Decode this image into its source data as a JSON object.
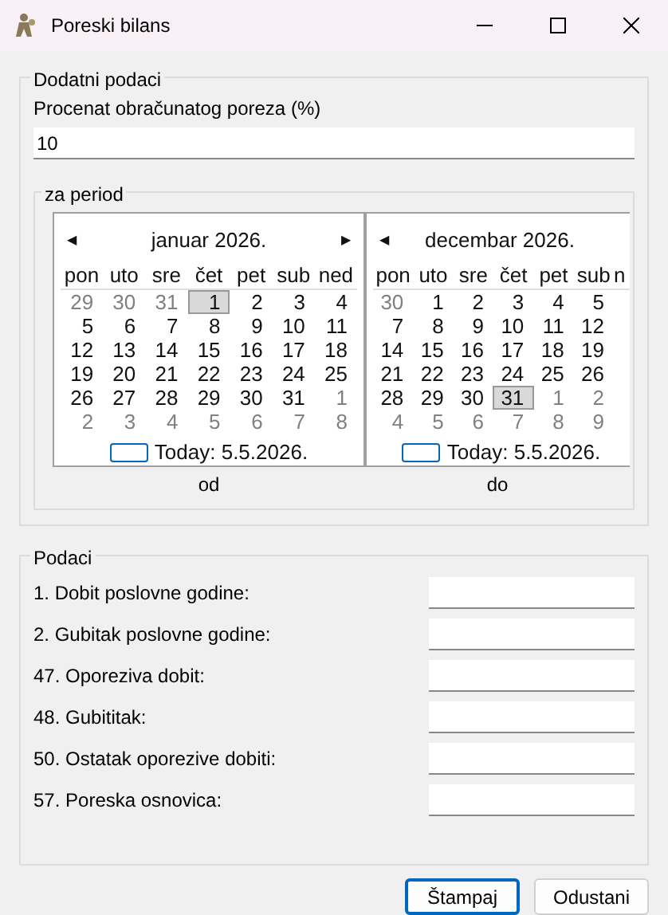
{
  "window": {
    "title": "Poreski bilans"
  },
  "extra": {
    "title": "Dodatni podaci",
    "tax_label": "Procenat obračunatog poreza (%)",
    "tax_value": "10"
  },
  "period": {
    "title": "za period",
    "calendars": [
      {
        "prev": "◀",
        "next": "▶",
        "month": "januar 2026.",
        "weekdays": [
          "pon",
          "uto",
          "sre",
          "čet",
          "pet",
          "sub",
          "ned"
        ],
        "today": "Today: 5.5.2026.",
        "caption": "od",
        "weeks": [
          [
            {
              "day": "29",
              "other": true,
              "selected": false
            },
            {
              "day": "30",
              "other": true,
              "selected": false
            },
            {
              "day": "31",
              "other": true,
              "selected": false
            },
            {
              "day": "1",
              "other": false,
              "selected": true
            },
            {
              "day": "2",
              "other": false,
              "selected": false
            },
            {
              "day": "3",
              "other": false,
              "selected": false
            },
            {
              "day": "4",
              "other": false,
              "selected": false
            }
          ],
          [
            {
              "day": "5",
              "other": false,
              "selected": false
            },
            {
              "day": "6",
              "other": false,
              "selected": false
            },
            {
              "day": "7",
              "other": false,
              "selected": false
            },
            {
              "day": "8",
              "other": false,
              "selected": false
            },
            {
              "day": "9",
              "other": false,
              "selected": false
            },
            {
              "day": "10",
              "other": false,
              "selected": false
            },
            {
              "day": "11",
              "other": false,
              "selected": false
            }
          ],
          [
            {
              "day": "12",
              "other": false,
              "selected": false
            },
            {
              "day": "13",
              "other": false,
              "selected": false
            },
            {
              "day": "14",
              "other": false,
              "selected": false
            },
            {
              "day": "15",
              "other": false,
              "selected": false
            },
            {
              "day": "16",
              "other": false,
              "selected": false
            },
            {
              "day": "17",
              "other": false,
              "selected": false
            },
            {
              "day": "18",
              "other": false,
              "selected": false
            }
          ],
          [
            {
              "day": "19",
              "other": false,
              "selected": false
            },
            {
              "day": "20",
              "other": false,
              "selected": false
            },
            {
              "day": "21",
              "other": false,
              "selected": false
            },
            {
              "day": "22",
              "other": false,
              "selected": false
            },
            {
              "day": "23",
              "other": false,
              "selected": false
            },
            {
              "day": "24",
              "other": false,
              "selected": false
            },
            {
              "day": "25",
              "other": false,
              "selected": false
            }
          ],
          [
            {
              "day": "26",
              "other": false,
              "selected": false
            },
            {
              "day": "27",
              "other": false,
              "selected": false
            },
            {
              "day": "28",
              "other": false,
              "selected": false
            },
            {
              "day": "29",
              "other": false,
              "selected": false
            },
            {
              "day": "30",
              "other": false,
              "selected": false
            },
            {
              "day": "31",
              "other": false,
              "selected": false
            },
            {
              "day": "1",
              "other": true,
              "selected": false
            }
          ],
          [
            {
              "day": "2",
              "other": true,
              "selected": false
            },
            {
              "day": "3",
              "other": true,
              "selected": false
            },
            {
              "day": "4",
              "other": true,
              "selected": false
            },
            {
              "day": "5",
              "other": true,
              "selected": false
            },
            {
              "day": "6",
              "other": true,
              "selected": false
            },
            {
              "day": "7",
              "other": true,
              "selected": false
            },
            {
              "day": "8",
              "other": true,
              "selected": false
            }
          ]
        ]
      },
      {
        "prev": "◀",
        "month": "decembar 2026.",
        "weekdays": [
          "pon",
          "uto",
          "sre",
          "čet",
          "pet",
          "sub",
          "n"
        ],
        "today": "Today: 5.5.2026.",
        "caption": "do",
        "weeks": [
          [
            {
              "day": "30",
              "other": true,
              "selected": false
            },
            {
              "day": "1",
              "other": false,
              "selected": false
            },
            {
              "day": "2",
              "other": false,
              "selected": false
            },
            {
              "day": "3",
              "other": false,
              "selected": false
            },
            {
              "day": "4",
              "other": false,
              "selected": false
            },
            {
              "day": "5",
              "other": false,
              "selected": false
            }
          ],
          [
            {
              "day": "7",
              "other": false,
              "selected": false
            },
            {
              "day": "8",
              "other": false,
              "selected": false
            },
            {
              "day": "9",
              "other": false,
              "selected": false
            },
            {
              "day": "10",
              "other": false,
              "selected": false
            },
            {
              "day": "11",
              "other": false,
              "selected": false
            },
            {
              "day": "12",
              "other": false,
              "selected": false
            }
          ],
          [
            {
              "day": "14",
              "other": false,
              "selected": false
            },
            {
              "day": "15",
              "other": false,
              "selected": false
            },
            {
              "day": "16",
              "other": false,
              "selected": false
            },
            {
              "day": "17",
              "other": false,
              "selected": false
            },
            {
              "day": "18",
              "other": false,
              "selected": false
            },
            {
              "day": "19",
              "other": false,
              "selected": false
            }
          ],
          [
            {
              "day": "21",
              "other": false,
              "selected": false
            },
            {
              "day": "22",
              "other": false,
              "selected": false
            },
            {
              "day": "23",
              "other": false,
              "selected": false
            },
            {
              "day": "24",
              "other": false,
              "selected": false
            },
            {
              "day": "25",
              "other": false,
              "selected": false
            },
            {
              "day": "26",
              "other": false,
              "selected": false
            }
          ],
          [
            {
              "day": "28",
              "other": false,
              "selected": false
            },
            {
              "day": "29",
              "other": false,
              "selected": false
            },
            {
              "day": "30",
              "other": false,
              "selected": false
            },
            {
              "day": "31",
              "other": false,
              "selected": true
            },
            {
              "day": "1",
              "other": true,
              "selected": false
            },
            {
              "day": "2",
              "other": true,
              "selected": false
            }
          ],
          [
            {
              "day": "4",
              "other": true,
              "selected": false
            },
            {
              "day": "5",
              "other": true,
              "selected": false
            },
            {
              "day": "6",
              "other": true,
              "selected": false
            },
            {
              "day": "7",
              "other": true,
              "selected": false
            },
            {
              "day": "8",
              "other": true,
              "selected": false
            },
            {
              "day": "9",
              "other": true,
              "selected": false
            }
          ]
        ]
      }
    ]
  },
  "data": {
    "title": "Podaci",
    "rows": [
      {
        "label": "1. Dobit poslovne godine:"
      },
      {
        "label": "2. Gubitak poslovne godine:"
      },
      {
        "label": "47. Oporeziva dobit:"
      },
      {
        "label": "48. Gubititak:"
      },
      {
        "label": "50. Ostatak oporezive dobiti:"
      },
      {
        "label": "57. Poreska osnovica:"
      }
    ]
  },
  "buttons": [
    "Štampaj",
    "Odustani"
  ]
}
